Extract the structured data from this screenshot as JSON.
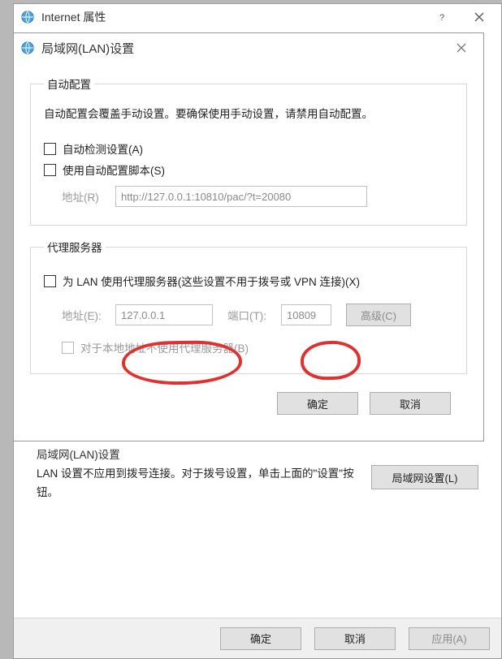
{
  "parent": {
    "title": "Internet 属性",
    "lan_section_header": "局域网(LAN)设置",
    "lan_desc": "LAN 设置不应用到拨号连接。对于拨号设置，单击上面的\"设置\"按钮。",
    "lan_button": "局域网设置(L)",
    "ok": "确定",
    "cancel": "取消",
    "apply": "应用(A)"
  },
  "child": {
    "title": "局域网(LAN)设置",
    "auto": {
      "legend": "自动配置",
      "desc": "自动配置会覆盖手动设置。要确保使用手动设置，请禁用自动配置。",
      "detect": "自动检测设置(A)",
      "script": "使用自动配置脚本(S)",
      "addr_label": "地址(R)",
      "addr_value": "http://127.0.0.1:10810/pac/?t=20080"
    },
    "proxy": {
      "legend": "代理服务器",
      "use": "为 LAN 使用代理服务器(这些设置不用于拨号或 VPN 连接)(X)",
      "addr_label": "地址(E):",
      "addr_value": "127.0.0.1",
      "port_label": "端口(T):",
      "port_value": "10809",
      "advanced": "高级(C)",
      "bypass": "对于本地地址不使用代理服务器(B)"
    },
    "ok": "确定",
    "cancel": "取消"
  }
}
